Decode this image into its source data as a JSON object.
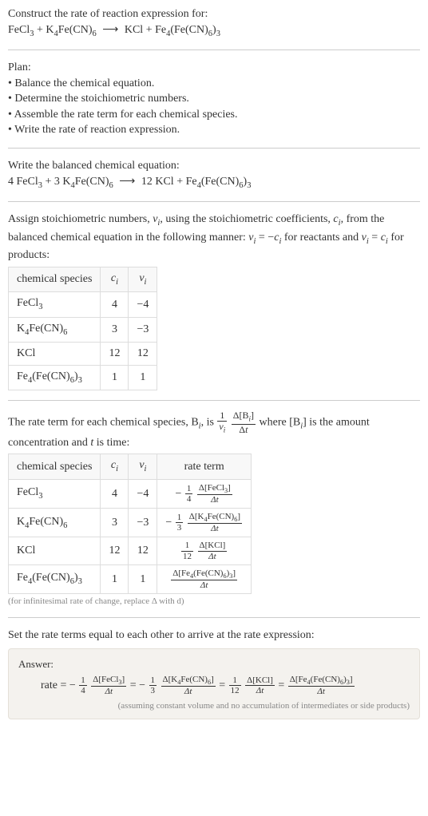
{
  "intro": {
    "construct": "Construct the rate of reaction expression for:",
    "equation_lhs1": "FeCl",
    "equation_lhs1_sub": "3",
    "equation_plus1": " + K",
    "equation_lhs2_sub": "4",
    "equation_lhs2": "Fe(CN)",
    "equation_lhs2b_sub": "6",
    "equation_arrow": "⟶",
    "equation_rhs1": "KCl + Fe",
    "equation_rhs2_sub": "4",
    "equation_rhs2": "(Fe(CN)",
    "equation_rhs3_sub": "6",
    "equation_rhs3": ")",
    "equation_rhs4_sub": "3"
  },
  "plan": {
    "heading": "Plan:",
    "b1": "• Balance the chemical equation.",
    "b2": "• Determine the stoichiometric numbers.",
    "b3": "• Assemble the rate term for each chemical species.",
    "b4": "• Write the rate of reaction expression."
  },
  "balanced": {
    "heading": "Write the balanced chemical equation:",
    "c1": "4 FeCl",
    "c1s": "3",
    "c2": " + 3 K",
    "c2s": "4",
    "c3": "Fe(CN)",
    "c3s": "6",
    "arrow": "⟶",
    "c4": "12 KCl + Fe",
    "c4s": "4",
    "c5": "(Fe(CN)",
    "c5s": "6",
    "c6": ")",
    "c6s": "3"
  },
  "assign": {
    "p1": "Assign stoichiometric numbers, ",
    "nu": "ν",
    "isub": "i",
    "p2": ", using the stoichiometric coefficients, ",
    "c": "c",
    "p3": ", from the balanced chemical equation in the following manner: ",
    "eq1": " = −",
    "p4": " for reactants and ",
    "eq2": " = ",
    "p5": " for products:"
  },
  "table1": {
    "h1": "chemical species",
    "h2": "c",
    "h2sub": "i",
    "h3": "ν",
    "h3sub": "i",
    "rows": [
      {
        "sp_a": "FeCl",
        "sp_as": "3",
        "sp_b": "",
        "sp_bs": "",
        "sp_c": "",
        "sp_cs": "",
        "sp_d": "",
        "sp_ds": "",
        "c": "4",
        "nu": "−4"
      },
      {
        "sp_a": "K",
        "sp_as": "4",
        "sp_b": "Fe(CN)",
        "sp_bs": "6",
        "sp_c": "",
        "sp_cs": "",
        "sp_d": "",
        "sp_ds": "",
        "c": "3",
        "nu": "−3"
      },
      {
        "sp_a": "KCl",
        "sp_as": "",
        "sp_b": "",
        "sp_bs": "",
        "sp_c": "",
        "sp_cs": "",
        "sp_d": "",
        "sp_ds": "",
        "c": "12",
        "nu": "12"
      },
      {
        "sp_a": "Fe",
        "sp_as": "4",
        "sp_b": "(Fe(CN)",
        "sp_bs": "6",
        "sp_c": ")",
        "sp_cs": "3",
        "sp_d": "",
        "sp_ds": "",
        "c": "1",
        "nu": "1"
      }
    ]
  },
  "rateterm": {
    "p1": "The rate term for each chemical species, B",
    "isub": "i",
    "p2": ", is ",
    "f1n": "1",
    "f1d_a": "ν",
    "f1d_b": "i",
    "f2n_a": "Δ[B",
    "f2n_b": "i",
    "f2n_c": "]",
    "f2d_a": "Δ",
    "f2d_b": "t",
    "p3": " where [B",
    "p4": "] is the amount concentration and ",
    "t": "t",
    "p5": " is time:"
  },
  "table2": {
    "h1": "chemical species",
    "h2": "c",
    "h2sub": "i",
    "h3": "ν",
    "h3sub": "i",
    "h4": "rate term",
    "rows": [
      {
        "sp_a": "FeCl",
        "sp_as": "3",
        "sp_b": "",
        "sp_bs": "",
        "sp_c": "",
        "sp_cs": "",
        "c": "4",
        "nu": "−4",
        "pre": "−",
        "f1n": "1",
        "f1d": "4",
        "f2n_a": "Δ[FeCl",
        "f2n_as": "3",
        "f2n_b": "]",
        "f2d": "Δt"
      },
      {
        "sp_a": "K",
        "sp_as": "4",
        "sp_b": "Fe(CN)",
        "sp_bs": "6",
        "sp_c": "",
        "sp_cs": "",
        "c": "3",
        "nu": "−3",
        "pre": "−",
        "f1n": "1",
        "f1d": "3",
        "f2n_a": "Δ[K",
        "f2n_as": "4",
        "f2n_b": "Fe(CN)",
        "f2n_bs": "6",
        "f2n_c": "]",
        "f2d": "Δt"
      },
      {
        "sp_a": "KCl",
        "sp_as": "",
        "sp_b": "",
        "sp_bs": "",
        "sp_c": "",
        "sp_cs": "",
        "c": "12",
        "nu": "12",
        "pre": "",
        "f1n": "1",
        "f1d": "12",
        "f2n_a": "Δ[KCl]",
        "f2n_as": "",
        "f2n_b": "",
        "f2d": "Δt"
      },
      {
        "sp_a": "Fe",
        "sp_as": "4",
        "sp_b": "(Fe(CN)",
        "sp_bs": "6",
        "sp_c": ")",
        "sp_cs": "3",
        "c": "1",
        "nu": "1",
        "pre": "",
        "f1n": "",
        "f1d": "",
        "f2n_a": "Δ[Fe",
        "f2n_as": "4",
        "f2n_b": "(Fe(CN)",
        "f2n_bs": "6",
        "f2n_c": ")",
        "f2n_cs": "3",
        "f2n_d": "]",
        "f2d": "Δt"
      }
    ],
    "note": "(for infinitesimal rate of change, replace Δ with d)"
  },
  "final": {
    "heading": "Set the rate terms equal to each other to arrive at the rate expression:"
  },
  "answer": {
    "label": "Answer:",
    "rate": "rate = −",
    "t1_f1n": "1",
    "t1_f1d": "4",
    "t1_f2n_a": "Δ[FeCl",
    "t1_f2n_as": "3",
    "t1_f2n_b": "]",
    "t1_f2d": "Δt",
    "eq": " = −",
    "t2_f1n": "1",
    "t2_f1d": "3",
    "t2_f2n_a": "Δ[K",
    "t2_f2n_as": "4",
    "t2_f2n_b": "Fe(CN)",
    "t2_f2n_bs": "6",
    "t2_f2n_c": "]",
    "t2_f2d": "Δt",
    "eq2": " = ",
    "t3_f1n": "1",
    "t3_f1d": "12",
    "t3_f2n_a": "Δ[KCl]",
    "t3_f2d": "Δt",
    "eq3": " = ",
    "t4_f2n_a": "Δ[Fe",
    "t4_f2n_as": "4",
    "t4_f2n_b": "(Fe(CN)",
    "t4_f2n_bs": "6",
    "t4_f2n_c": ")",
    "t4_f2n_cs": "3",
    "t4_f2n_d": "]",
    "t4_f2d": "Δt",
    "note": "(assuming constant volume and no accumulation of intermediates or side products)"
  }
}
